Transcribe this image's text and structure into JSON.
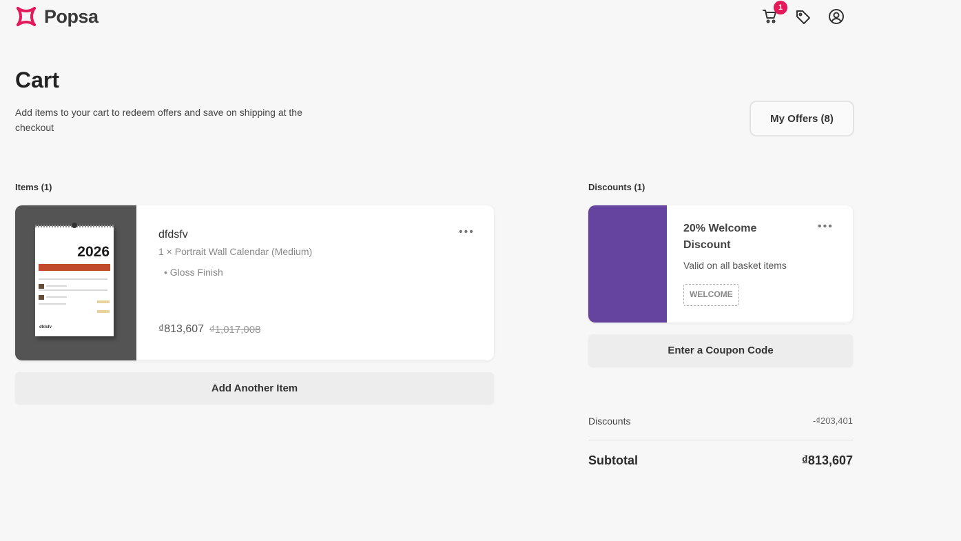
{
  "header": {
    "brand": "Popsa",
    "cart_count": "1",
    "brand_color": "#e4195a"
  },
  "page": {
    "title": "Cart",
    "subtitle": "Add items to your cart to redeem offers and save on shipping at the checkout",
    "offers_button": "My Offers (8)"
  },
  "items": {
    "label": "Items (1)",
    "list": [
      {
        "name": "dfdsfv",
        "description": "1 × Portrait Wall Calendar (Medium)",
        "option": "• Gloss Finish",
        "price": "₫813,607",
        "original_price": "₫1,017,008",
        "thumb_year": "2026",
        "thumb_name": "dfdsfv"
      }
    ],
    "add_button": "Add Another Item"
  },
  "discounts": {
    "label": "Discounts (1)",
    "card": {
      "title": "20% Welcome Discount",
      "subtitle": "Valid on all basket items",
      "code": "WELCOME",
      "color": "#6544a0"
    },
    "coupon_button": "Enter a Coupon Code"
  },
  "summary": {
    "discounts_label": "Discounts",
    "discounts_value": "-₫203,401",
    "subtotal_label": "Subtotal",
    "subtotal_value": "₫813,607"
  },
  "icons": [
    "popsa-logo-icon",
    "cart-icon",
    "tag-icon",
    "account-icon",
    "more-options-icon"
  ]
}
